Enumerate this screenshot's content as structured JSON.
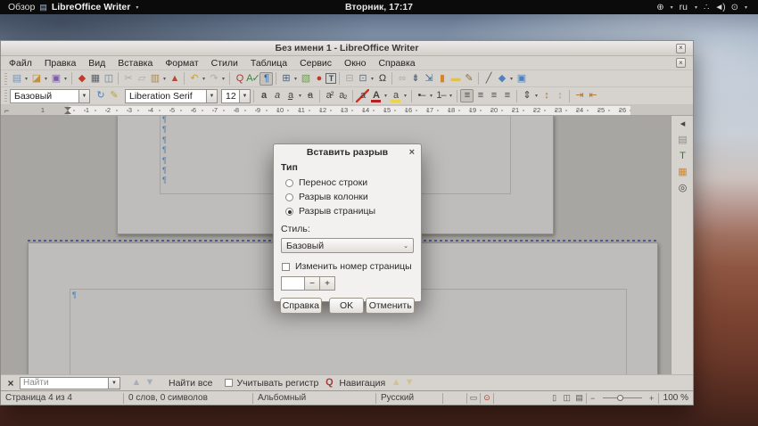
{
  "desktop": {
    "activities_label": "Обзор",
    "app_menu_label": "LibreOffice Writer",
    "clock": "Вторник, 17:17",
    "keyboard_layout": "ru",
    "icons": {
      "document": "▤",
      "globe": "⊕",
      "caret": "▾",
      "network": "∴",
      "volume": "◄)",
      "power": "⊙"
    }
  },
  "window": {
    "title": "Без имени 1 - LibreOffice Writer",
    "close_glyph": "×",
    "menubar": [
      "Файл",
      "Правка",
      "Вид",
      "Вставка",
      "Формат",
      "Стили",
      "Таблица",
      "Сервис",
      "Окно",
      "Справка"
    ],
    "standard_toolbar": [
      {
        "n": "new-document-icon",
        "g": "▤",
        "col": "#6f94c0",
        "dd": 1
      },
      {
        "n": "open-icon",
        "g": "◪",
        "col": "#c28f3f",
        "dd": 1
      },
      {
        "n": "save-icon",
        "g": "▣",
        "col": "#7b5ea7",
        "dd": 1
      },
      {
        "sep": 1
      },
      {
        "n": "export-pdf-icon",
        "g": "◆",
        "col": "#c23b2a"
      },
      {
        "n": "print-icon",
        "g": "▦",
        "col": "#58606a"
      },
      {
        "n": "print-preview-icon",
        "g": "◫",
        "col": "#6b7f94"
      },
      {
        "sep": 1
      },
      {
        "n": "cut-icon",
        "g": "✂",
        "col": "#555555",
        "off": 1
      },
      {
        "n": "copy-icon",
        "g": "▱",
        "col": "#555555",
        "off": 1
      },
      {
        "n": "paste-icon",
        "g": "▥",
        "col": "#a98a50",
        "dd": 1
      },
      {
        "n": "clone-formatting-icon",
        "g": "▲",
        "col": "#b5493a"
      },
      {
        "sep": 1
      },
      {
        "n": "undo-icon",
        "g": "↶",
        "col": "#c9a227",
        "dd": 1
      },
      {
        "n": "redo-icon",
        "g": "↷",
        "col": "#666666",
        "off": 1,
        "dd": 1
      },
      {
        "sep": 1
      },
      {
        "n": "find-replace-icon",
        "g": "Q",
        "col": "#a33b3b"
      },
      {
        "n": "spelling-icon",
        "g": "A✓",
        "col": "#3f7d3f"
      },
      {
        "n": "formatting-marks-icon",
        "g": "¶",
        "col": "#3465a4",
        "act": 1
      },
      {
        "sep": 1
      },
      {
        "n": "insert-table-icon",
        "g": "⊞",
        "col": "#44617e",
        "dd": 1
      },
      {
        "n": "insert-image-icon",
        "g": "▧",
        "col": "#6f9a53"
      },
      {
        "n": "insert-chart-icon",
        "g": "●",
        "col": "#c0392b"
      },
      {
        "n": "insert-textbox-icon",
        "g": "T",
        "box": 1
      },
      {
        "sep": 1
      },
      {
        "n": "insert-page-break-icon",
        "g": "⊟",
        "col": "#555555",
        "off": 1
      },
      {
        "n": "insert-field-icon",
        "g": "⊡",
        "col": "#5a6b7c",
        "dd": 1
      },
      {
        "n": "special-character-icon",
        "g": "Ω",
        "col": "#333333"
      },
      {
        "sep": 1
      },
      {
        "n": "insert-hyperlink-icon",
        "g": "∞",
        "col": "#555555",
        "off": 1
      },
      {
        "n": "insert-footnote-icon",
        "g": "⇟",
        "col": "#44617e"
      },
      {
        "n": "insert-endnote-icon",
        "g": "⇲",
        "col": "#44617e"
      },
      {
        "n": "insert-bookmark-icon",
        "g": "▮",
        "col": "#d1872c"
      },
      {
        "n": "insert-comment-icon",
        "g": "▬",
        "col": "#dfc24f"
      },
      {
        "n": "track-changes-icon",
        "g": "✎",
        "col": "#8a6d3b"
      },
      {
        "sep": 1
      },
      {
        "n": "insert-line-icon",
        "g": "╱",
        "col": "#555555"
      },
      {
        "n": "basic-shapes-icon",
        "g": "◆",
        "col": "#4f81bd",
        "dd": 1
      },
      {
        "n": "show-draw-functions-icon",
        "g": "▣",
        "col": "#4f81bd"
      }
    ],
    "formatting_toolbar": {
      "paragraph_style": "Базовый",
      "font_name": "Liberation Serif",
      "font_size": "12",
      "style_icons": [
        {
          "n": "update-style-icon",
          "g": "↻",
          "col": "#4f81bd"
        },
        {
          "n": "new-style-icon",
          "g": "✎",
          "col": "#b8a23c"
        }
      ],
      "icons": [
        {
          "n": "bold-icon",
          "g": "a",
          "cls": "fb"
        },
        {
          "n": "italic-icon",
          "g": "a",
          "cls": "fi"
        },
        {
          "n": "underline-icon",
          "g": "a",
          "cls": "fu",
          "dd": 1
        },
        {
          "n": "strikethrough-icon",
          "g": "a",
          "cls": "fsx"
        },
        {
          "sep": 1
        },
        {
          "n": "superscript-icon",
          "g": "a²"
        },
        {
          "n": "subscript-icon",
          "g": "a₂"
        },
        {
          "sep": 1
        },
        {
          "n": "clear-formatting-icon",
          "g": "a",
          "cls": "fx"
        },
        {
          "n": "font-color-icon",
          "g": "A",
          "cls": "fcolor",
          "dd": 1
        },
        {
          "n": "highlight-color-icon",
          "g": "a",
          "cls": "fhl",
          "dd": 1
        },
        {
          "sep": 1
        },
        {
          "n": "bullet-list-icon",
          "g": "•–",
          "dd": 1
        },
        {
          "n": "numbered-list-icon",
          "g": "1–",
          "dd": 1
        },
        {
          "sep": 1
        },
        {
          "n": "align-left-icon",
          "g": "≡",
          "act": 1
        },
        {
          "n": "align-center-icon",
          "g": "≡"
        },
        {
          "n": "align-right-icon",
          "g": "≡"
        },
        {
          "n": "justify-icon",
          "g": "≡"
        },
        {
          "sep": 1
        },
        {
          "n": "line-spacing-icon",
          "g": "⇕",
          "dd": 1
        },
        {
          "n": "para-space-increase-icon",
          "g": "↕",
          "col": "#b5712f"
        },
        {
          "n": "para-space-decrease-icon",
          "g": "↕",
          "off": 1
        },
        {
          "sep": 1
        },
        {
          "n": "increase-indent-icon",
          "g": "⇥",
          "col": "#b5712f"
        },
        {
          "n": "decrease-indent-icon",
          "g": "⇤",
          "col": "#b5712f"
        }
      ]
    },
    "ruler": {
      "pre": "1",
      "numbers": [
        "1",
        "2",
        "3",
        "4",
        "5",
        "6",
        "7",
        "8",
        "9",
        "10",
        "11",
        "12",
        "13",
        "14",
        "15",
        "16",
        "17",
        "18",
        "19",
        "20",
        "21",
        "22",
        "23",
        "24",
        "25",
        "26"
      ]
    },
    "sidebar_icons": [
      {
        "n": "sidebar-settings-icon",
        "g": "◂",
        "col": "#444444"
      },
      {
        "n": "properties-icon",
        "g": "▤",
        "col": "#8f8c88"
      },
      {
        "n": "styles-icon",
        "g": "T",
        "col": "#2e7d32"
      },
      {
        "n": "gallery-icon",
        "g": "▦",
        "col": "#d1872c"
      },
      {
        "n": "navigator-icon",
        "g": "◎",
        "col": "#444444"
      }
    ],
    "document_view": {
      "pilcrow": "¶",
      "page3_pilcrows": 7,
      "page4_pilcrows": 1
    },
    "find_bar": {
      "close_glyph": "×",
      "placeholder": "Найти",
      "find_all": "Найти все",
      "match_case": "Учитывать регистр",
      "navigation": "Навигация"
    },
    "status_bar": {
      "page": "Страница 4 из 4",
      "words": "0 слов, 0 символов",
      "page_style": "Альбомный",
      "language": "Русский",
      "zoom": "100 %",
      "zoom_minus": "−",
      "zoom_plus": "+"
    }
  },
  "dialog": {
    "title": "Вставить разрыв",
    "close_glyph": "×",
    "type_group_label": "Тип",
    "options": [
      {
        "label": "Перенос строки",
        "selected": false
      },
      {
        "label": "Разрыв колонки",
        "selected": false
      },
      {
        "label": "Разрыв страницы",
        "selected": true
      }
    ],
    "style_label": "Стиль:",
    "style_value": "Базовый",
    "style_chevron": "⌄",
    "change_page_number_label": "Изменить номер страницы",
    "page_number_value": "",
    "decrement_label": "−",
    "increment_label": "+",
    "help_button": "Справка",
    "ok_button": "OK",
    "cancel_button": "Отменить"
  }
}
